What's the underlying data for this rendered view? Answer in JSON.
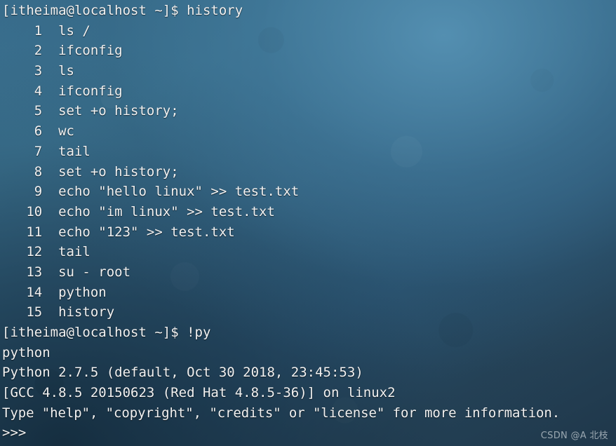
{
  "terminal": {
    "colors": {
      "background_light": "#3d7391",
      "background_mid": "#35657f",
      "background_dark": "#1f374a",
      "foreground": "#f2f2f2",
      "watermark": "#e2e8ec"
    },
    "prompt": "[itheima@localhost ~]$ ",
    "lines": [
      {
        "id": "prompt-history",
        "text": "[itheima@localhost ~]$ history"
      },
      {
        "id": "history-1",
        "text": "    1  ls /"
      },
      {
        "id": "history-2",
        "text": "    2  ifconfig"
      },
      {
        "id": "history-3",
        "text": "    3  ls"
      },
      {
        "id": "history-4",
        "text": "    4  ifconfig"
      },
      {
        "id": "history-5",
        "text": "    5  set +o history;"
      },
      {
        "id": "history-6",
        "text": "    6  wc"
      },
      {
        "id": "history-7",
        "text": "    7  tail"
      },
      {
        "id": "history-8",
        "text": "    8  set +o history;"
      },
      {
        "id": "history-9",
        "text": "    9  echo \"hello linux\" >> test.txt"
      },
      {
        "id": "history-10",
        "text": "   10  echo \"im linux\" >> test.txt"
      },
      {
        "id": "history-11",
        "text": "   11  echo \"123\" >> test.txt"
      },
      {
        "id": "history-12",
        "text": "   12  tail"
      },
      {
        "id": "history-13",
        "text": "   13  su - root"
      },
      {
        "id": "history-14",
        "text": "   14  python"
      },
      {
        "id": "history-15",
        "text": "   15  history"
      },
      {
        "id": "prompt-bang-py",
        "text": "[itheima@localhost ~]$ !py"
      },
      {
        "id": "echoed-command",
        "text": "python"
      },
      {
        "id": "python-version",
        "text": "Python 2.7.5 (default, Oct 30 2018, 23:45:53)"
      },
      {
        "id": "python-build",
        "text": "[GCC 4.8.5 20150623 (Red Hat 4.8.5-36)] on linux2"
      },
      {
        "id": "python-help-hint",
        "text": "Type \"help\", \"copyright\", \"credits\" or \"license\" for more information.",
        "condensed": true
      },
      {
        "id": "python-prompt",
        "text": ">>>"
      }
    ],
    "history_entries": [
      {
        "number": "1",
        "command": "ls /"
      },
      {
        "number": "2",
        "command": "ifconfig"
      },
      {
        "number": "3",
        "command": "ls"
      },
      {
        "number": "4",
        "command": "ifconfig"
      },
      {
        "number": "5",
        "command": "set +o history;"
      },
      {
        "number": "6",
        "command": "wc"
      },
      {
        "number": "7",
        "command": "tail"
      },
      {
        "number": "8",
        "command": "set +o history;"
      },
      {
        "number": "9",
        "command": "echo \"hello linux\" >> test.txt"
      },
      {
        "number": "10",
        "command": "echo \"im linux\" >> test.txt"
      },
      {
        "number": "11",
        "command": "echo \"123\" >> test.txt"
      },
      {
        "number": "12",
        "command": "tail"
      },
      {
        "number": "13",
        "command": "su - root"
      },
      {
        "number": "14",
        "command": "python"
      },
      {
        "number": "15",
        "command": "history"
      }
    ]
  },
  "watermark": {
    "text": "CSDN @A 北枝"
  }
}
